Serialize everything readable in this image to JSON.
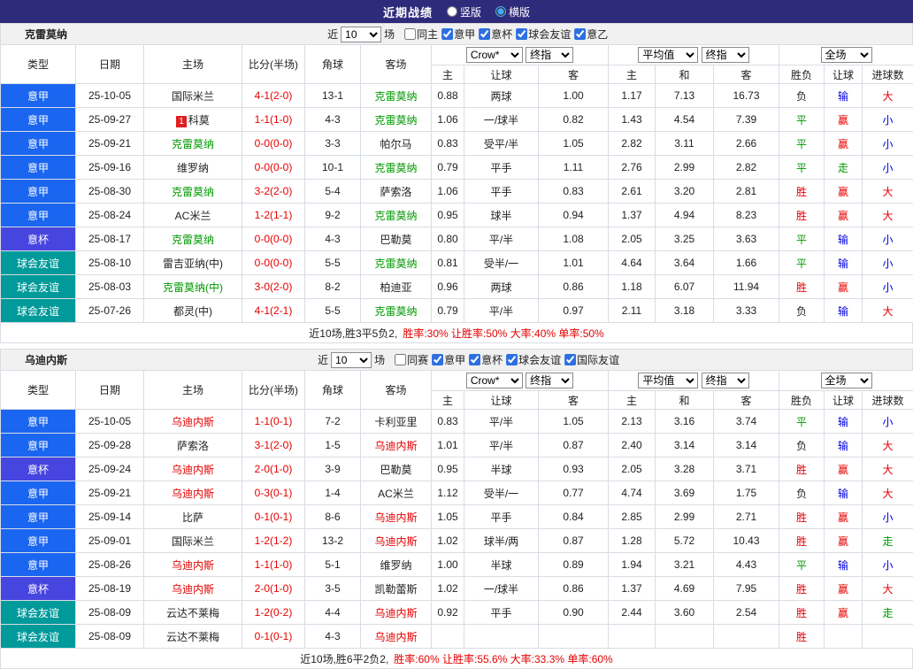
{
  "topbar": {
    "title": "近期战绩",
    "radios": [
      {
        "label": "竖版",
        "selected": false
      },
      {
        "label": "横版",
        "selected": true
      }
    ]
  },
  "headers": {
    "cols": [
      "类型",
      "日期",
      "主场",
      "比分(半场)",
      "角球",
      "客场"
    ],
    "odds_group": {
      "bookmaker": "Crow*",
      "index_type": "终指",
      "cols": [
        "主",
        "让球",
        "客"
      ]
    },
    "avg_group": {
      "label": "平均值",
      "index_type": "终指",
      "cols": [
        "主",
        "和",
        "客"
      ]
    },
    "result_group": {
      "scope": "全场",
      "cols": [
        "胜负",
        "让球",
        "进球数"
      ]
    }
  },
  "filter": {
    "prefix": "近",
    "count": "10",
    "suffix": "场"
  },
  "colors": {
    "topbar_bg": "#2f2b7b",
    "serie_a_badge": "#1b66f0",
    "coppa_badge": "#4745e0",
    "friendly_badge": "#009a9a",
    "focus_team_green": "#009900",
    "focus_team_red": "#e60000",
    "score_red": "#e60000",
    "win_red": "#e60000",
    "draw_green": "#009900",
    "lose_blue": "#0000e0"
  },
  "sections": [
    {
      "team": "克雷莫纳",
      "filters": [
        {
          "label": "同主",
          "checked": false
        },
        {
          "label": "意甲",
          "checked": true
        },
        {
          "label": "意杯",
          "checked": true
        },
        {
          "label": "球会友谊",
          "checked": true
        },
        {
          "label": "意乙",
          "checked": true
        }
      ],
      "rows": [
        {
          "type": "意甲",
          "tc": "lg",
          "date": "25-10-05",
          "home": "国际米兰",
          "hc": "",
          "score": "4-1(2-0)",
          "cor": "13-1",
          "away": "克雷莫纳",
          "ac": "green",
          "o": [
            "0.88",
            "两球",
            "1.00"
          ],
          "a": [
            "1.17",
            "7.13",
            "16.73"
          ],
          "r": [
            [
              "负",
              "k"
            ],
            [
              "输",
              "b"
            ],
            [
              "大",
              "r"
            ]
          ]
        },
        {
          "type": "意甲",
          "tc": "lg",
          "date": "25-09-27",
          "home": "科莫",
          "hb": "1",
          "hc": "",
          "score": "1-1(1-0)",
          "cor": "4-3",
          "away": "克雷莫纳",
          "ac": "green",
          "o": [
            "1.06",
            "一/球半",
            "0.82"
          ],
          "a": [
            "1.43",
            "4.54",
            "7.39"
          ],
          "r": [
            [
              "平",
              "g"
            ],
            [
              "赢",
              "r"
            ],
            [
              "小",
              "b"
            ]
          ]
        },
        {
          "type": "意甲",
          "tc": "lg",
          "date": "25-09-21",
          "home": "克雷莫纳",
          "hc": "green",
          "score": "0-0(0-0)",
          "cor": "3-3",
          "away": "帕尔马",
          "ac": "",
          "o": [
            "0.83",
            "受平/半",
            "1.05"
          ],
          "a": [
            "2.82",
            "3.11",
            "2.66"
          ],
          "r": [
            [
              "平",
              "g"
            ],
            [
              "赢",
              "r"
            ],
            [
              "小",
              "b"
            ]
          ]
        },
        {
          "type": "意甲",
          "tc": "lg",
          "date": "25-09-16",
          "home": "维罗纳",
          "hc": "",
          "score": "0-0(0-0)",
          "cor": "10-1",
          "away": "克雷莫纳",
          "ac": "green",
          "o": [
            "0.79",
            "平手",
            "1.11"
          ],
          "a": [
            "2.76",
            "2.99",
            "2.82"
          ],
          "r": [
            [
              "平",
              "g"
            ],
            [
              "走",
              "g"
            ],
            [
              "小",
              "b"
            ]
          ]
        },
        {
          "type": "意甲",
          "tc": "lg",
          "date": "25-08-30",
          "home": "克雷莫纳",
          "hc": "green",
          "score": "3-2(2-0)",
          "cor": "5-4",
          "away": "萨索洛",
          "ac": "",
          "o": [
            "1.06",
            "平手",
            "0.83"
          ],
          "a": [
            "2.61",
            "3.20",
            "2.81"
          ],
          "r": [
            [
              "胜",
              "r"
            ],
            [
              "赢",
              "r"
            ],
            [
              "大",
              "r"
            ]
          ]
        },
        {
          "type": "意甲",
          "tc": "lg",
          "date": "25-08-24",
          "home": "AC米兰",
          "hc": "",
          "score": "1-2(1-1)",
          "cor": "9-2",
          "away": "克雷莫纳",
          "ac": "green",
          "o": [
            "0.95",
            "球半",
            "0.94"
          ],
          "a": [
            "1.37",
            "4.94",
            "8.23"
          ],
          "r": [
            [
              "胜",
              "r"
            ],
            [
              "赢",
              "r"
            ],
            [
              "大",
              "r"
            ]
          ]
        },
        {
          "type": "意杯",
          "tc": "cup",
          "date": "25-08-17",
          "home": "克雷莫纳",
          "hc": "green",
          "score": "0-0(0-0)",
          "cor": "4-3",
          "away": "巴勒莫",
          "ac": "",
          "o": [
            "0.80",
            "平/半",
            "1.08"
          ],
          "a": [
            "2.05",
            "3.25",
            "3.63"
          ],
          "r": [
            [
              "平",
              "g"
            ],
            [
              "输",
              "b"
            ],
            [
              "小",
              "b"
            ]
          ]
        },
        {
          "type": "球会友谊",
          "tc": "fr",
          "date": "25-08-10",
          "home": "雷吉亚纳(中)",
          "hc": "",
          "score": "0-0(0-0)",
          "cor": "5-5",
          "away": "克雷莫纳",
          "ac": "green",
          "o": [
            "0.81",
            "受半/一",
            "1.01"
          ],
          "a": [
            "4.64",
            "3.64",
            "1.66"
          ],
          "r": [
            [
              "平",
              "g"
            ],
            [
              "输",
              "b"
            ],
            [
              "小",
              "b"
            ]
          ]
        },
        {
          "type": "球会友谊",
          "tc": "fr",
          "date": "25-08-03",
          "home": "克雷莫纳(中)",
          "hc": "green",
          "score": "3-0(2-0)",
          "cor": "8-2",
          "away": "柏迪亚",
          "ac": "",
          "o": [
            "0.96",
            "两球",
            "0.86"
          ],
          "a": [
            "1.18",
            "6.07",
            "11.94"
          ],
          "r": [
            [
              "胜",
              "r"
            ],
            [
              "赢",
              "r"
            ],
            [
              "小",
              "b"
            ]
          ]
        },
        {
          "type": "球会友谊",
          "tc": "fr",
          "date": "25-07-26",
          "home": "都灵(中)",
          "hc": "",
          "score": "4-1(2-1)",
          "cor": "5-5",
          "away": "克雷莫纳",
          "ac": "green",
          "o": [
            "0.79",
            "平/半",
            "0.97"
          ],
          "a": [
            "2.11",
            "3.18",
            "3.33"
          ],
          "r": [
            [
              "负",
              "k"
            ],
            [
              "输",
              "b"
            ],
            [
              "大",
              "r"
            ]
          ]
        }
      ],
      "summary_plain": "近10场,胜3平5负2,",
      "summary_stats": "胜率:30% 让胜率:50% 大率:40% 单率:50%"
    },
    {
      "team": "乌迪内斯",
      "filters": [
        {
          "label": "同赛",
          "checked": false
        },
        {
          "label": "意甲",
          "checked": true
        },
        {
          "label": "意杯",
          "checked": true
        },
        {
          "label": "球会友谊",
          "checked": true
        },
        {
          "label": "国际友谊",
          "checked": true
        }
      ],
      "rows": [
        {
          "type": "意甲",
          "tc": "lg",
          "date": "25-10-05",
          "home": "乌迪内斯",
          "hc": "red",
          "score": "1-1(0-1)",
          "cor": "7-2",
          "away": "卡利亚里",
          "ac": "",
          "o": [
            "0.83",
            "平/半",
            "1.05"
          ],
          "a": [
            "2.13",
            "3.16",
            "3.74"
          ],
          "r": [
            [
              "平",
              "g"
            ],
            [
              "输",
              "b"
            ],
            [
              "小",
              "b"
            ]
          ]
        },
        {
          "type": "意甲",
          "tc": "lg",
          "date": "25-09-28",
          "home": "萨索洛",
          "hc": "",
          "score": "3-1(2-0)",
          "cor": "1-5",
          "away": "乌迪内斯",
          "ac": "red",
          "o": [
            "1.01",
            "平/半",
            "0.87"
          ],
          "a": [
            "2.40",
            "3.14",
            "3.14"
          ],
          "r": [
            [
              "负",
              "k"
            ],
            [
              "输",
              "b"
            ],
            [
              "大",
              "r"
            ]
          ]
        },
        {
          "type": "意杯",
          "tc": "cup",
          "date": "25-09-24",
          "home": "乌迪内斯",
          "hc": "red",
          "score": "2-0(1-0)",
          "cor": "3-9",
          "away": "巴勒莫",
          "ac": "",
          "o": [
            "0.95",
            "半球",
            "0.93"
          ],
          "a": [
            "2.05",
            "3.28",
            "3.71"
          ],
          "r": [
            [
              "胜",
              "r"
            ],
            [
              "赢",
              "r"
            ],
            [
              "大",
              "r"
            ]
          ]
        },
        {
          "type": "意甲",
          "tc": "lg",
          "date": "25-09-21",
          "home": "乌迪内斯",
          "hc": "red",
          "score": "0-3(0-1)",
          "cor": "1-4",
          "away": "AC米兰",
          "ac": "",
          "o": [
            "1.12",
            "受半/一",
            "0.77"
          ],
          "a": [
            "4.74",
            "3.69",
            "1.75"
          ],
          "r": [
            [
              "负",
              "k"
            ],
            [
              "输",
              "b"
            ],
            [
              "大",
              "r"
            ]
          ]
        },
        {
          "type": "意甲",
          "tc": "lg",
          "date": "25-09-14",
          "home": "比萨",
          "hc": "",
          "score": "0-1(0-1)",
          "cor": "8-6",
          "away": "乌迪内斯",
          "ac": "red",
          "o": [
            "1.05",
            "平手",
            "0.84"
          ],
          "a": [
            "2.85",
            "2.99",
            "2.71"
          ],
          "r": [
            [
              "胜",
              "r"
            ],
            [
              "赢",
              "r"
            ],
            [
              "小",
              "b"
            ]
          ]
        },
        {
          "type": "意甲",
          "tc": "lg",
          "date": "25-09-01",
          "home": "国际米兰",
          "hc": "",
          "score": "1-2(1-2)",
          "cor": "13-2",
          "away": "乌迪内斯",
          "ac": "red",
          "o": [
            "1.02",
            "球半/两",
            "0.87"
          ],
          "a": [
            "1.28",
            "5.72",
            "10.43"
          ],
          "r": [
            [
              "胜",
              "r"
            ],
            [
              "赢",
              "r"
            ],
            [
              "走",
              "g"
            ]
          ]
        },
        {
          "type": "意甲",
          "tc": "lg",
          "date": "25-08-26",
          "home": "乌迪内斯",
          "hc": "red",
          "score": "1-1(1-0)",
          "cor": "5-1",
          "away": "维罗纳",
          "ac": "",
          "o": [
            "1.00",
            "半球",
            "0.89"
          ],
          "a": [
            "1.94",
            "3.21",
            "4.43"
          ],
          "r": [
            [
              "平",
              "g"
            ],
            [
              "输",
              "b"
            ],
            [
              "小",
              "b"
            ]
          ]
        },
        {
          "type": "意杯",
          "tc": "cup",
          "date": "25-08-19",
          "home": "乌迪内斯",
          "hc": "red",
          "score": "2-0(1-0)",
          "cor": "3-5",
          "away": "凯勒蕾斯",
          "ac": "",
          "o": [
            "1.02",
            "一/球半",
            "0.86"
          ],
          "a": [
            "1.37",
            "4.69",
            "7.95"
          ],
          "r": [
            [
              "胜",
              "r"
            ],
            [
              "赢",
              "r"
            ],
            [
              "大",
              "r"
            ]
          ]
        },
        {
          "type": "球会友谊",
          "tc": "fr",
          "date": "25-08-09",
          "home": "云达不莱梅",
          "hc": "",
          "score": "1-2(0-2)",
          "cor": "4-4",
          "away": "乌迪内斯",
          "ac": "red",
          "o": [
            "0.92",
            "平手",
            "0.90"
          ],
          "a": [
            "2.44",
            "3.60",
            "2.54"
          ],
          "r": [
            [
              "胜",
              "r"
            ],
            [
              "赢",
              "r"
            ],
            [
              "走",
              "g"
            ]
          ]
        },
        {
          "type": "球会友谊",
          "tc": "fr",
          "date": "25-08-09",
          "home": "云达不莱梅",
          "hc": "",
          "score": "0-1(0-1)",
          "cor": "4-3",
          "away": "乌迪内斯",
          "ac": "red",
          "o": [
            "",
            "",
            ""
          ],
          "a": [
            "",
            "",
            ""
          ],
          "r": [
            [
              "胜",
              "r"
            ],
            [
              "",
              ""
            ],
            [
              "",
              ""
            ]
          ]
        }
      ],
      "summary_plain": "近10场,胜6平2负2,",
      "summary_stats": "胜率:60% 让胜率:55.6% 大率:33.3% 单率:60%"
    }
  ]
}
